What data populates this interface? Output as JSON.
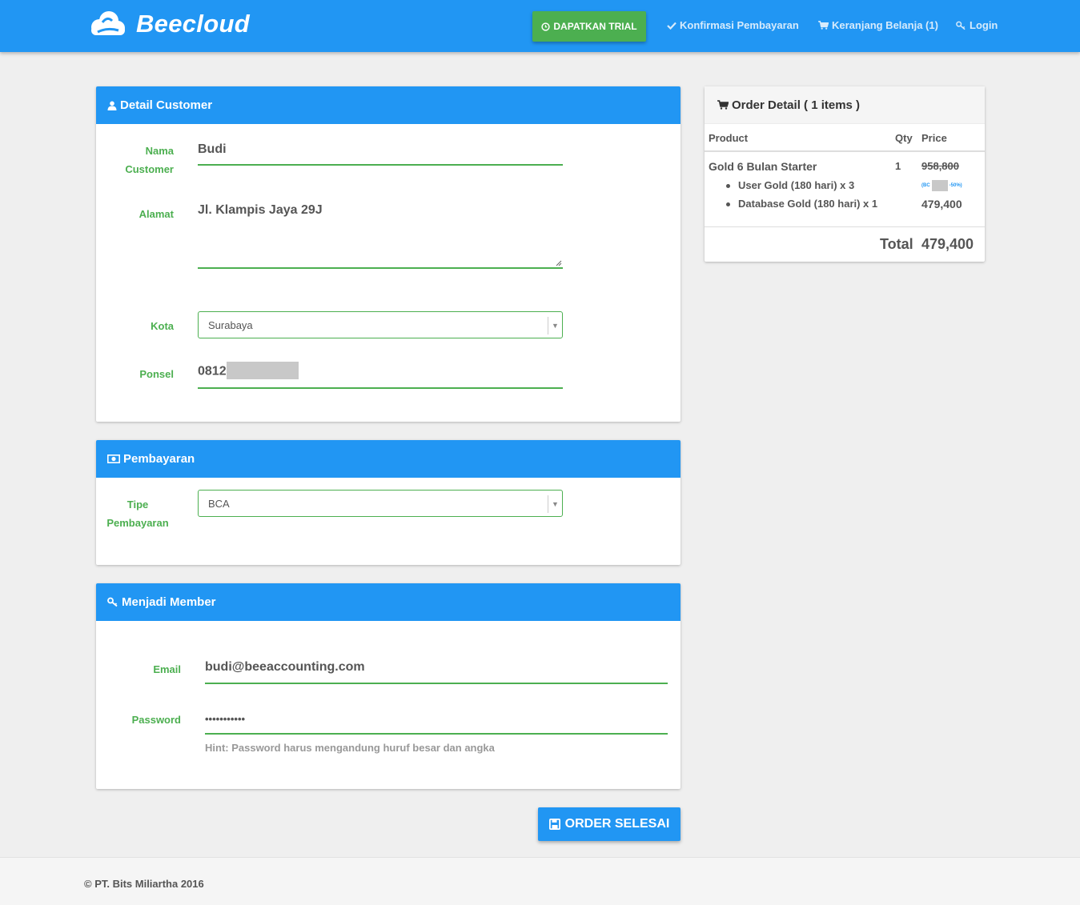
{
  "colors": {
    "primary": "#2196f3",
    "success": "#4caf50",
    "background": "#efefef"
  },
  "navbar": {
    "brand": "Beecloud",
    "trial_button": "DAPATKAN TRIAL",
    "links": [
      {
        "icon": "check-icon",
        "label": "Konfirmasi Pembayaran"
      },
      {
        "icon": "cart-icon",
        "label": "Keranjang Belanja (1)"
      },
      {
        "icon": "key-icon",
        "label": "Login"
      }
    ]
  },
  "customer": {
    "title": "Detail Customer",
    "name_label_1": "Nama",
    "name_label_2": "Customer",
    "name_value": "Budi",
    "address_label": "Alamat",
    "address_value": "Jl. Klampis Jaya 29J",
    "city_label": "Kota",
    "city_value": "Surabaya",
    "phone_label": "Ponsel",
    "phone_value": "0812"
  },
  "payment": {
    "title": "Pembayaran",
    "type_label_1": "Tipe",
    "type_label_2": "Pembayaran",
    "type_value": "BCA"
  },
  "member": {
    "title": "Menjadi Member",
    "email_label": "Email",
    "email_value": "budi@beeaccounting.com",
    "password_label": "Password",
    "password_value": "•••••••••••",
    "hint": "Hint: Password harus mengandung huruf besar dan angka"
  },
  "order": {
    "title": "Order Detail ( 1 items )",
    "col_product": "Product",
    "col_qty": "Qty",
    "col_price": "Price",
    "item_name": "Gold 6 Bulan Starter",
    "item_qty": "1",
    "original_price": "958,800",
    "discount_prefix": "(BC",
    "discount_suffix": "-50%)",
    "sub_items": [
      "User Gold (180 hari) x 3",
      "Database Gold (180 hari) x 1"
    ],
    "final_price": "479,400",
    "total_label": "Total",
    "total_value": "479,400"
  },
  "submit_button": "ORDER SELESAI",
  "footer": "© PT. Bits Miliartha 2016"
}
